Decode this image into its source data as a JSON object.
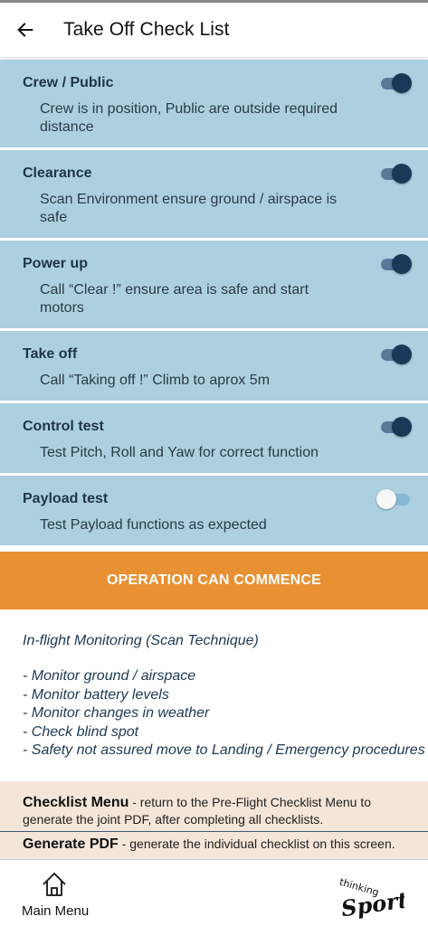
{
  "header": {
    "title": "Take Off Check List"
  },
  "checklist": [
    {
      "title": "Crew / Public",
      "desc": "Crew is in position, Public are outside required distance",
      "checked": true
    },
    {
      "title": "Clearance",
      "desc": "Scan Environment ensure ground / airspace is safe",
      "checked": true
    },
    {
      "title": "Power up",
      "desc": "Call “Clear !” ensure area is safe and start motors",
      "checked": true
    },
    {
      "title": "Take off",
      "desc": "Call “Taking off !” Climb to aprox 5m",
      "checked": true
    },
    {
      "title": "Control test",
      "desc": "Test Pitch, Roll and Yaw for correct function",
      "checked": true
    },
    {
      "title": "Payload test",
      "desc": "Test Payload functions as expected",
      "checked": false
    }
  ],
  "status_banner": {
    "label": "OPERATION CAN COMMENCE",
    "color": "#e79133"
  },
  "monitoring": {
    "title": "In-flight Monitoring (Scan Technique)",
    "items": [
      "- Monitor ground / airspace",
      "- Monitor battery levels",
      "- Monitor changes in weather",
      "- Check blind spot",
      "- Safety not assured move to Landing / Emergency procedures"
    ]
  },
  "info": {
    "checklist_menu_label": "Checklist Menu",
    "checklist_menu_text": " - return to the Pre-Flight Checklist Menu to generate the joint PDF, after completing all checklists.",
    "generate_pdf_label": "Generate PDF",
    "generate_pdf_text": " - generate the individual checklist on this screen."
  },
  "bottom_nav": {
    "main_menu_label": "Main Menu",
    "logo_top": "thinking",
    "logo_main": "Sports"
  },
  "colors": {
    "item_bg": "#acd0e0",
    "toggle_on": "#183a58",
    "info_bg": "#f3e6d9",
    "accent": "#e79133"
  }
}
